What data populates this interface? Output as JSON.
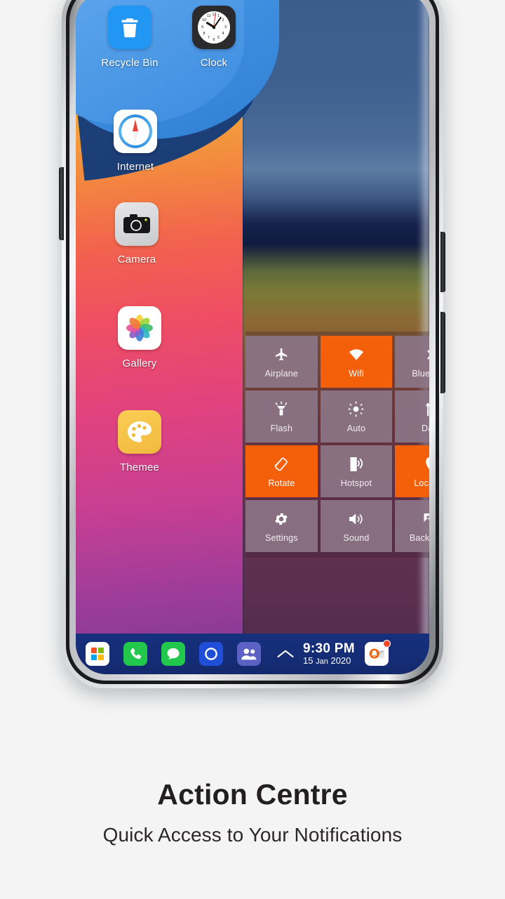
{
  "caption": {
    "title": "Action Centre",
    "subtitle": "Quick Access to Your Notifications"
  },
  "colors": {
    "accent_active_tile": "#f4600a",
    "inactive_tile": "#8b7585",
    "taskbar": "#17307e",
    "page_background": "#f4f4f4",
    "notification_badge": "#f04623"
  },
  "desktop": {
    "icons": [
      {
        "id": "recycle-bin",
        "label": "Recycle Bin",
        "icon": "trash-icon"
      },
      {
        "id": "clock",
        "label": "Clock",
        "icon": "clock-icon"
      },
      {
        "id": "internet",
        "label": "Internet",
        "icon": "compass-icon"
      },
      {
        "id": "camera",
        "label": "Camera",
        "icon": "camera-icon"
      },
      {
        "id": "gallery",
        "label": "Gallery",
        "icon": "photos-flower-icon"
      },
      {
        "id": "themee",
        "label": "Themee",
        "icon": "palette-icon"
      }
    ]
  },
  "action_centre": {
    "tiles": [
      {
        "label": "Airplane",
        "icon": "airplane-icon",
        "active": false
      },
      {
        "label": "Wifi",
        "icon": "wifi-icon",
        "active": true
      },
      {
        "label": "Bluetooth",
        "icon": "bluetooth-icon",
        "active": false
      },
      {
        "label": "Flash",
        "icon": "flashlight-icon",
        "active": false
      },
      {
        "label": "Auto",
        "icon": "brightness-icon",
        "active": false
      },
      {
        "label": "Data",
        "icon": "data-arrows-icon",
        "active": false
      },
      {
        "label": "Rotate",
        "icon": "rotate-icon",
        "active": true
      },
      {
        "label": "Hotspot",
        "icon": "hotspot-icon",
        "active": false
      },
      {
        "label": "Location",
        "icon": "location-pin-icon",
        "active": true
      },
      {
        "label": "Settings",
        "icon": "gear-icon",
        "active": false
      },
      {
        "label": "Sound",
        "icon": "speaker-icon",
        "active": false
      },
      {
        "label": "Backgrond",
        "icon": "image-icon",
        "active": false
      }
    ]
  },
  "taskbar": {
    "items": [
      {
        "id": "start",
        "icon": "windows-start-icon"
      },
      {
        "id": "phone",
        "icon": "phone-icon"
      },
      {
        "id": "messages",
        "icon": "message-bubble-icon"
      },
      {
        "id": "cortana",
        "icon": "cortana-ring-icon"
      },
      {
        "id": "people",
        "icon": "people-icon"
      },
      {
        "id": "tray",
        "icon": "chevron-up-icon"
      }
    ],
    "clock": {
      "time": "9:30 PM",
      "day": "15",
      "month": "Jan",
      "year": "2020"
    },
    "notification": {
      "icon": "notification-bell-icon",
      "has_badge": true
    }
  },
  "clock_widget": {
    "numerals": [
      "12",
      "1",
      "2",
      "3",
      "4",
      "5",
      "6",
      "7",
      "8",
      "9",
      "10",
      "11"
    ]
  }
}
